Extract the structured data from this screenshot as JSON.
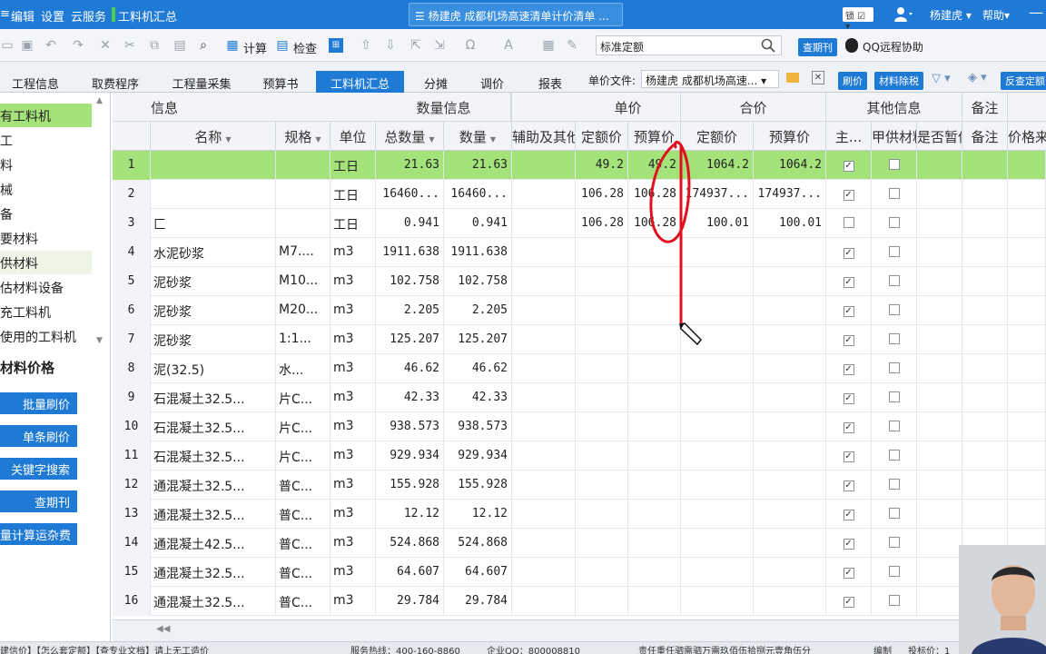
{
  "titlebar": {
    "menu_edit": "编辑",
    "menu_settings": "设置",
    "menu_cloud": "云服务",
    "menu_summary": "工料机汇总",
    "doc_tab": "☰ 杨建虎 成都机场高速清单计价清单 ...",
    "lock_label": "锁",
    "user": "杨建虎 ▾",
    "help": "帮助▾",
    "accent": "#1f7ad6"
  },
  "toolbar": {
    "calc_label": "计算",
    "check_label": "检查",
    "quota_select_value": "标准定额",
    "check_journal_btn": "查期刊",
    "qq_help": "QQ远程协助"
  },
  "tabs": [
    {
      "label": "工程信息"
    },
    {
      "label": "取费程序"
    },
    {
      "label": "工程量采集"
    },
    {
      "label": "预算书"
    },
    {
      "label": "工料机汇总",
      "active": true
    },
    {
      "label": "分摊"
    },
    {
      "label": "调价"
    },
    {
      "label": "报表"
    }
  ],
  "unitfile": {
    "label": "单价文件:",
    "value": "杨建虎 成都机场高速...",
    "brush_btn": "刷价",
    "tax_btn": "材料除税",
    "reverse_btn": "反查定额"
  },
  "left_panel": {
    "items": [
      {
        "label": "有工料机",
        "selected": true
      },
      {
        "label": "工"
      },
      {
        "label": "料"
      },
      {
        "label": "械"
      },
      {
        "label": "备"
      },
      {
        "label": "要材料"
      },
      {
        "label": "供材料",
        "hover": true
      },
      {
        "label": "估材料设备"
      },
      {
        "label": "充工料机"
      },
      {
        "label": "使用的工料机"
      }
    ],
    "price_title": "材料价格",
    "buttons": [
      "批量刷价",
      "单条刷价",
      "关键字搜索",
      "查期刊",
      "量计算运杂费"
    ]
  },
  "grid": {
    "group_headers": [
      "信息",
      "数量信息",
      "单价",
      "合价",
      "其他信息",
      "备注"
    ],
    "columns": [
      "名称",
      "规格",
      "单位",
      "总数量",
      "数量",
      "辅助及其他",
      "定额价",
      "预算价",
      "定额价",
      "预算价",
      "主...",
      "甲供材料",
      "是否暂估",
      "备注",
      "价格来源"
    ],
    "rows": [
      {
        "idx": "1",
        "name": "",
        "spec": "",
        "unit": "工日",
        "total": "21.63",
        "qty": "21.63",
        "quota_price": "49.2",
        "budget_price": "49.2",
        "quota_total": "1064.2",
        "budget_total": "1064.2",
        "main": true,
        "supply": false
      },
      {
        "idx": "2",
        "name": "",
        "spec": "",
        "unit": "工日",
        "total": "16460...",
        "qty": "16460...",
        "quota_price": "106.28",
        "budget_price": "106.28",
        "quota_total": "174937...",
        "budget_total": "174937...",
        "main": true,
        "supply": false
      },
      {
        "idx": "3",
        "name": "匚",
        "spec": "",
        "unit": "工日",
        "total": "0.941",
        "qty": "0.941",
        "quota_price": "106.28",
        "budget_price": "106.28",
        "quota_total": "100.01",
        "budget_total": "100.01",
        "main": false,
        "supply": false
      },
      {
        "idx": "4",
        "name": "水泥砂浆",
        "spec": "M7....",
        "unit": "m3",
        "total": "1911.638",
        "qty": "1911.638",
        "main": true,
        "supply": false
      },
      {
        "idx": "5",
        "name": "泥砂浆",
        "spec": "M10...",
        "unit": "m3",
        "total": "102.758",
        "qty": "102.758",
        "main": true,
        "supply": false
      },
      {
        "idx": "6",
        "name": "泥砂浆",
        "spec": "M20...",
        "unit": "m3",
        "total": "2.205",
        "qty": "2.205",
        "main": true,
        "supply": false
      },
      {
        "idx": "7",
        "name": "泥砂浆",
        "spec": "1:1...",
        "unit": "m3",
        "total": "125.207",
        "qty": "125.207",
        "main": true,
        "supply": false
      },
      {
        "idx": "8",
        "name": "泥(32.5)",
        "spec": "水...",
        "unit": "m3",
        "total": "46.62",
        "qty": "46.62",
        "main": true,
        "supply": false
      },
      {
        "idx": "9",
        "name": "石混凝土32.5...",
        "spec": "片C...",
        "unit": "m3",
        "total": "42.33",
        "qty": "42.33",
        "main": true,
        "supply": false
      },
      {
        "idx": "10",
        "name": "石混凝土32.5...",
        "spec": "片C...",
        "unit": "m3",
        "total": "938.573",
        "qty": "938.573",
        "main": true,
        "supply": false
      },
      {
        "idx": "11",
        "name": "石混凝土32.5...",
        "spec": "片C...",
        "unit": "m3",
        "total": "929.934",
        "qty": "929.934",
        "main": true,
        "supply": false
      },
      {
        "idx": "12",
        "name": "通混凝土32.5...",
        "spec": "普C...",
        "unit": "m3",
        "total": "155.928",
        "qty": "155.928",
        "main": true,
        "supply": false
      },
      {
        "idx": "13",
        "name": "通混凝土32.5...",
        "spec": "普C...",
        "unit": "m3",
        "total": "12.12",
        "qty": "12.12",
        "main": true,
        "supply": false
      },
      {
        "idx": "14",
        "name": "通混凝土42.5...",
        "spec": "普C...",
        "unit": "m3",
        "total": "524.868",
        "qty": "524.868",
        "main": true,
        "supply": false
      },
      {
        "idx": "15",
        "name": "通混凝土32.5...",
        "spec": "普C...",
        "unit": "m3",
        "total": "64.607",
        "qty": "64.607",
        "main": true,
        "supply": false
      },
      {
        "idx": "16",
        "name": "通混凝土32.5...",
        "spec": "普C...",
        "unit": "m3",
        "total": "29.784",
        "qty": "29.784",
        "main": true,
        "supply": false
      }
    ]
  },
  "statusbar": {
    "left": "建信价】【怎么套定额】【查专业文档】请上无工造价",
    "hotline": "服务热线：400-160-8860",
    "qq": "企业QQ：800008810",
    "slogan": "责任重任驷需驷万需玖佰伍拾捌元壹角伍分",
    "mode": "编制",
    "bid": "投标价：1"
  },
  "annotation_color": "#e0101e"
}
